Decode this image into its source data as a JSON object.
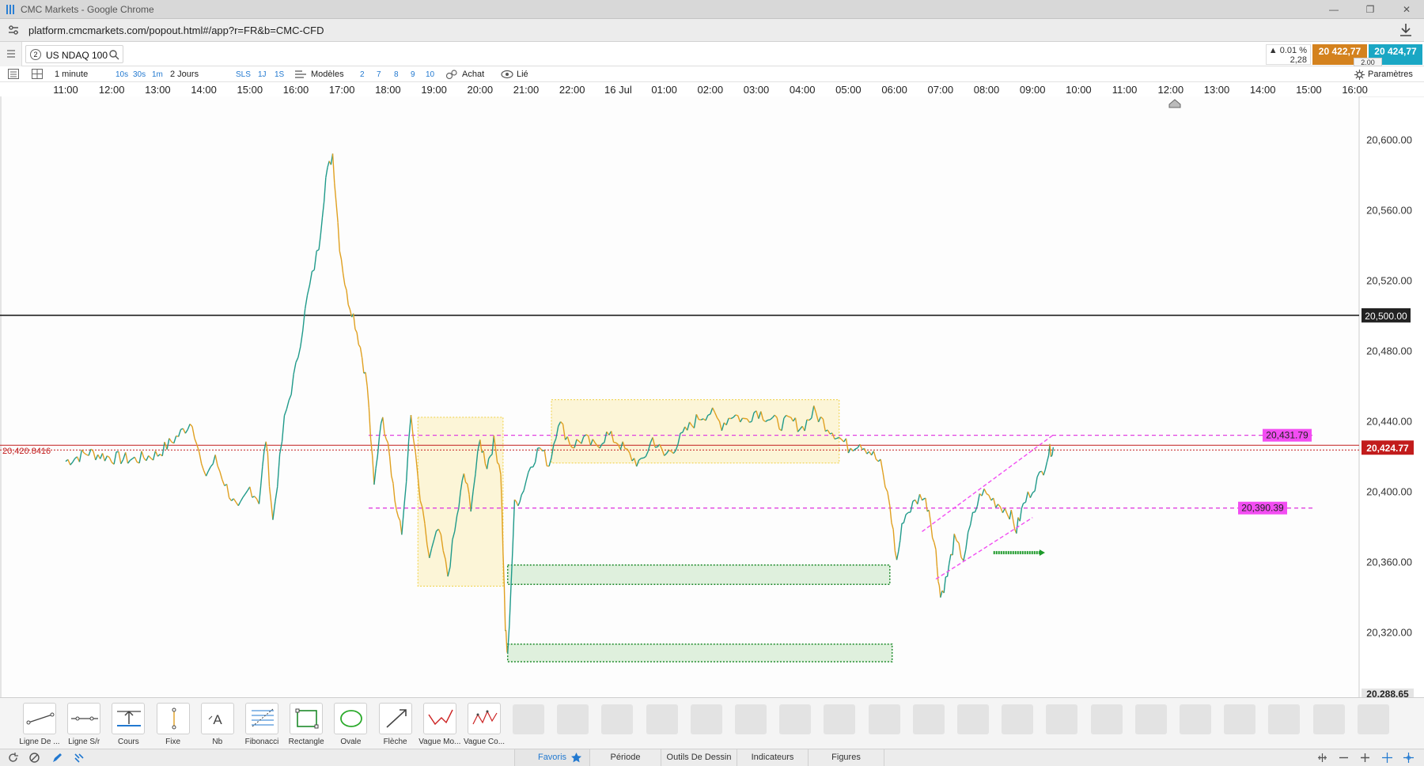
{
  "window": {
    "title": "CMC Markets - Google Chrome",
    "minimize": "—",
    "restore": "❐",
    "close": "✕"
  },
  "address": {
    "url": "platform.cmcmarkets.com/popout.html#/app?r=FR&b=CMC-CFD"
  },
  "instrument": {
    "number": "2",
    "name": "US NDAQ 100"
  },
  "quote": {
    "change_pct": "▲ 0.01 %",
    "change_pts": "2,28",
    "sell": "20 422,77",
    "buy": "20 424,77",
    "spread": "2.00",
    "sell_color": "#d4821e",
    "buy_color": "#1aa7c4"
  },
  "toolbar": {
    "interval": "1 minute",
    "quick_intervals": [
      "10s",
      "30s",
      "1m"
    ],
    "range": "2 Jours",
    "modes": [
      "SLS",
      "1J",
      "1S"
    ],
    "templates": "Modèles",
    "numbers": [
      "2",
      "7",
      "8",
      "9",
      "10"
    ],
    "buy": "Achat",
    "linked": "Lié",
    "settings": "Paramètres"
  },
  "chart_data": {
    "type": "line",
    "instrument": "US NDAQ 100",
    "x_ticks": [
      "11:00",
      "12:00",
      "13:00",
      "14:00",
      "15:00",
      "16:00",
      "17:00",
      "18:00",
      "19:00",
      "20:00",
      "21:00",
      "22:00",
      "16 Jul",
      "01:00",
      "02:00",
      "03:00",
      "04:00",
      "05:00",
      "06:00",
      "07:00",
      "08:00",
      "09:00",
      "10:00",
      "11:00",
      "12:00",
      "13:00",
      "14:00",
      "15:00",
      "16:00"
    ],
    "y_ticks": [
      "20,600.00",
      "20,560.00",
      "20,520.00",
      "20,480.00",
      "20,440.00",
      "20,400.00",
      "20,360.00",
      "20,320.00"
    ],
    "ylim": [
      20288.65,
      20620
    ],
    "price_path": [
      {
        "t": 0,
        "v": 20417
      },
      {
        "t": 1,
        "v": 20422
      },
      {
        "t": 2,
        "v": 20419
      },
      {
        "t": 3,
        "v": 20418
      },
      {
        "t": 4,
        "v": 20421
      },
      {
        "t": 5,
        "v": 20433
      },
      {
        "t": 5.5,
        "v": 20440
      },
      {
        "t": 6,
        "v": 20408
      },
      {
        "t": 6.5,
        "v": 20418
      },
      {
        "t": 7,
        "v": 20402
      },
      {
        "t": 7.5,
        "v": 20388
      },
      {
        "t": 8,
        "v": 20402
      },
      {
        "t": 8.4,
        "v": 20395
      },
      {
        "t": 8.7,
        "v": 20430
      },
      {
        "t": 9,
        "v": 20383
      },
      {
        "t": 9.5,
        "v": 20440
      },
      {
        "t": 10,
        "v": 20470
      },
      {
        "t": 10.5,
        "v": 20510
      },
      {
        "t": 11,
        "v": 20540
      },
      {
        "t": 11.3,
        "v": 20578
      },
      {
        "t": 11.6,
        "v": 20592
      },
      {
        "t": 11.9,
        "v": 20540
      },
      {
        "t": 12.2,
        "v": 20512
      },
      {
        "t": 12.5,
        "v": 20500
      },
      {
        "t": 12.8,
        "v": 20482
      },
      {
        "t": 13.1,
        "v": 20460
      },
      {
        "t": 13.4,
        "v": 20402
      },
      {
        "t": 13.7,
        "v": 20442
      },
      {
        "t": 14,
        "v": 20430
      },
      {
        "t": 14.3,
        "v": 20395
      },
      {
        "t": 14.6,
        "v": 20375
      },
      {
        "t": 15,
        "v": 20442
      },
      {
        "t": 15.4,
        "v": 20395
      },
      {
        "t": 15.8,
        "v": 20362
      },
      {
        "t": 16.2,
        "v": 20378
      },
      {
        "t": 16.6,
        "v": 20352
      },
      {
        "t": 17,
        "v": 20385
      },
      {
        "t": 17.3,
        "v": 20410
      },
      {
        "t": 17.6,
        "v": 20392
      },
      {
        "t": 18,
        "v": 20428
      },
      {
        "t": 18.3,
        "v": 20415
      },
      {
        "t": 18.6,
        "v": 20428
      },
      {
        "t": 18.9,
        "v": 20412
      },
      {
        "t": 19.1,
        "v": 20322
      },
      {
        "t": 19.2,
        "v": 20305
      },
      {
        "t": 19.5,
        "v": 20392
      },
      {
        "t": 19.8,
        "v": 20398
      },
      {
        "t": 20.2,
        "v": 20415
      },
      {
        "t": 20.6,
        "v": 20425
      },
      {
        "t": 21,
        "v": 20415
      },
      {
        "t": 21.4,
        "v": 20440
      },
      {
        "t": 22,
        "v": 20426
      },
      {
        "t": 22.5,
        "v": 20430
      },
      {
        "t": 23,
        "v": 20425
      },
      {
        "t": 23.5,
        "v": 20432
      },
      {
        "t": 24,
        "v": 20428
      },
      {
        "t": 24.5,
        "v": 20420
      },
      {
        "t": 25,
        "v": 20415
      },
      {
        "t": 25.5,
        "v": 20430
      },
      {
        "t": 26,
        "v": 20420
      },
      {
        "t": 26.5,
        "v": 20426
      },
      {
        "t": 27,
        "v": 20435
      },
      {
        "t": 27.5,
        "v": 20442
      },
      {
        "t": 28,
        "v": 20445
      },
      {
        "t": 28.5,
        "v": 20438
      },
      {
        "t": 29,
        "v": 20444
      },
      {
        "t": 29.5,
        "v": 20440
      },
      {
        "t": 30,
        "v": 20446
      },
      {
        "t": 30.5,
        "v": 20442
      },
      {
        "t": 31,
        "v": 20438
      },
      {
        "t": 31.5,
        "v": 20440
      },
      {
        "t": 32,
        "v": 20436
      },
      {
        "t": 32.5,
        "v": 20445
      },
      {
        "t": 33,
        "v": 20438
      },
      {
        "t": 33.5,
        "v": 20432
      },
      {
        "t": 34,
        "v": 20425
      },
      {
        "t": 34.5,
        "v": 20428
      },
      {
        "t": 35,
        "v": 20422
      },
      {
        "t": 35.4,
        "v": 20415
      },
      {
        "t": 35.8,
        "v": 20392
      },
      {
        "t": 36.1,
        "v": 20360
      },
      {
        "t": 36.4,
        "v": 20385
      },
      {
        "t": 36.8,
        "v": 20392
      },
      {
        "t": 37.2,
        "v": 20398
      },
      {
        "t": 37.5,
        "v": 20390
      },
      {
        "t": 37.8,
        "v": 20365
      },
      {
        "t": 38,
        "v": 20340
      },
      {
        "t": 38.3,
        "v": 20352
      },
      {
        "t": 38.6,
        "v": 20372
      },
      {
        "t": 39,
        "v": 20362
      },
      {
        "t": 39.4,
        "v": 20385
      },
      {
        "t": 39.8,
        "v": 20400
      },
      {
        "t": 40.2,
        "v": 20396
      },
      {
        "t": 40.6,
        "v": 20392
      },
      {
        "t": 41,
        "v": 20388
      },
      {
        "t": 41.3,
        "v": 20378
      },
      {
        "t": 41.6,
        "v": 20392
      },
      {
        "t": 42,
        "v": 20402
      },
      {
        "t": 42.4,
        "v": 20410
      },
      {
        "t": 42.7,
        "v": 20422
      },
      {
        "t": 42.9,
        "v": 20425
      }
    ],
    "price_path_note_t_unit": "half-hours from 11:00",
    "hlines": [
      {
        "price": 20500,
        "label": "20,500.00",
        "style": "solid",
        "color": "#111111"
      },
      {
        "price": 20431.79,
        "label": "20,431.79",
        "style": "dashed",
        "color": "#e040e0"
      },
      {
        "price": 20390.39,
        "label": "20,390.39",
        "style": "dashed",
        "color": "#e040e0"
      },
      {
        "price": 20424.77,
        "label": "20,424.77",
        "style": "current",
        "color": "#c21c1c"
      }
    ],
    "axis_min_label": "20,288.65",
    "left_price_label": "20,420.8416",
    "yellow_boxes": [
      {
        "t0": 15.3,
        "t1": 19.0,
        "p_top": 20442,
        "p_bot": 20346
      },
      {
        "t0": 21.1,
        "t1": 33.6,
        "p_top": 20452,
        "p_bot": 20416
      }
    ],
    "green_boxes": [
      {
        "t0": 19.2,
        "t1": 35.8,
        "p_top": 20358,
        "p_bot": 20347
      },
      {
        "t0": 19.2,
        "t1": 35.9,
        "p_top": 20313,
        "p_bot": 20303
      }
    ],
    "channel": [
      {
        "from": {
          "t": 37.2,
          "v": 20377
        },
        "to": {
          "t": 42.9,
          "v": 20432
        }
      },
      {
        "from": {
          "t": 37.8,
          "v": 20350
        },
        "to": {
          "t": 42.0,
          "v": 20385
        }
      }
    ],
    "green_arrow": {
      "t0": 40.3,
      "t1": 42.3,
      "price": 20365
    }
  },
  "drawing_tools": [
    {
      "label": "Ligne De ...",
      "icon": "trend-line-icon"
    },
    {
      "label": "Ligne S/r",
      "icon": "support-line-icon"
    },
    {
      "label": "Cours",
      "icon": "price-icon"
    },
    {
      "label": "Fixe",
      "icon": "fixed-icon"
    },
    {
      "label": "Nb",
      "icon": "text-note-icon"
    },
    {
      "label": "Fibonacci",
      "icon": "fibonacci-icon"
    },
    {
      "label": "Rectangle",
      "icon": "rectangle-icon"
    },
    {
      "label": "Ovale",
      "icon": "oval-icon"
    },
    {
      "label": "Flèche",
      "icon": "arrow-icon"
    },
    {
      "label": "Vague Mo...",
      "icon": "wave-icon"
    },
    {
      "label": "Vague Co...",
      "icon": "wave-correction-icon"
    }
  ],
  "tabs": [
    "Favoris",
    "Période",
    "Outils De Dessin",
    "Indicateurs",
    "Figures"
  ]
}
